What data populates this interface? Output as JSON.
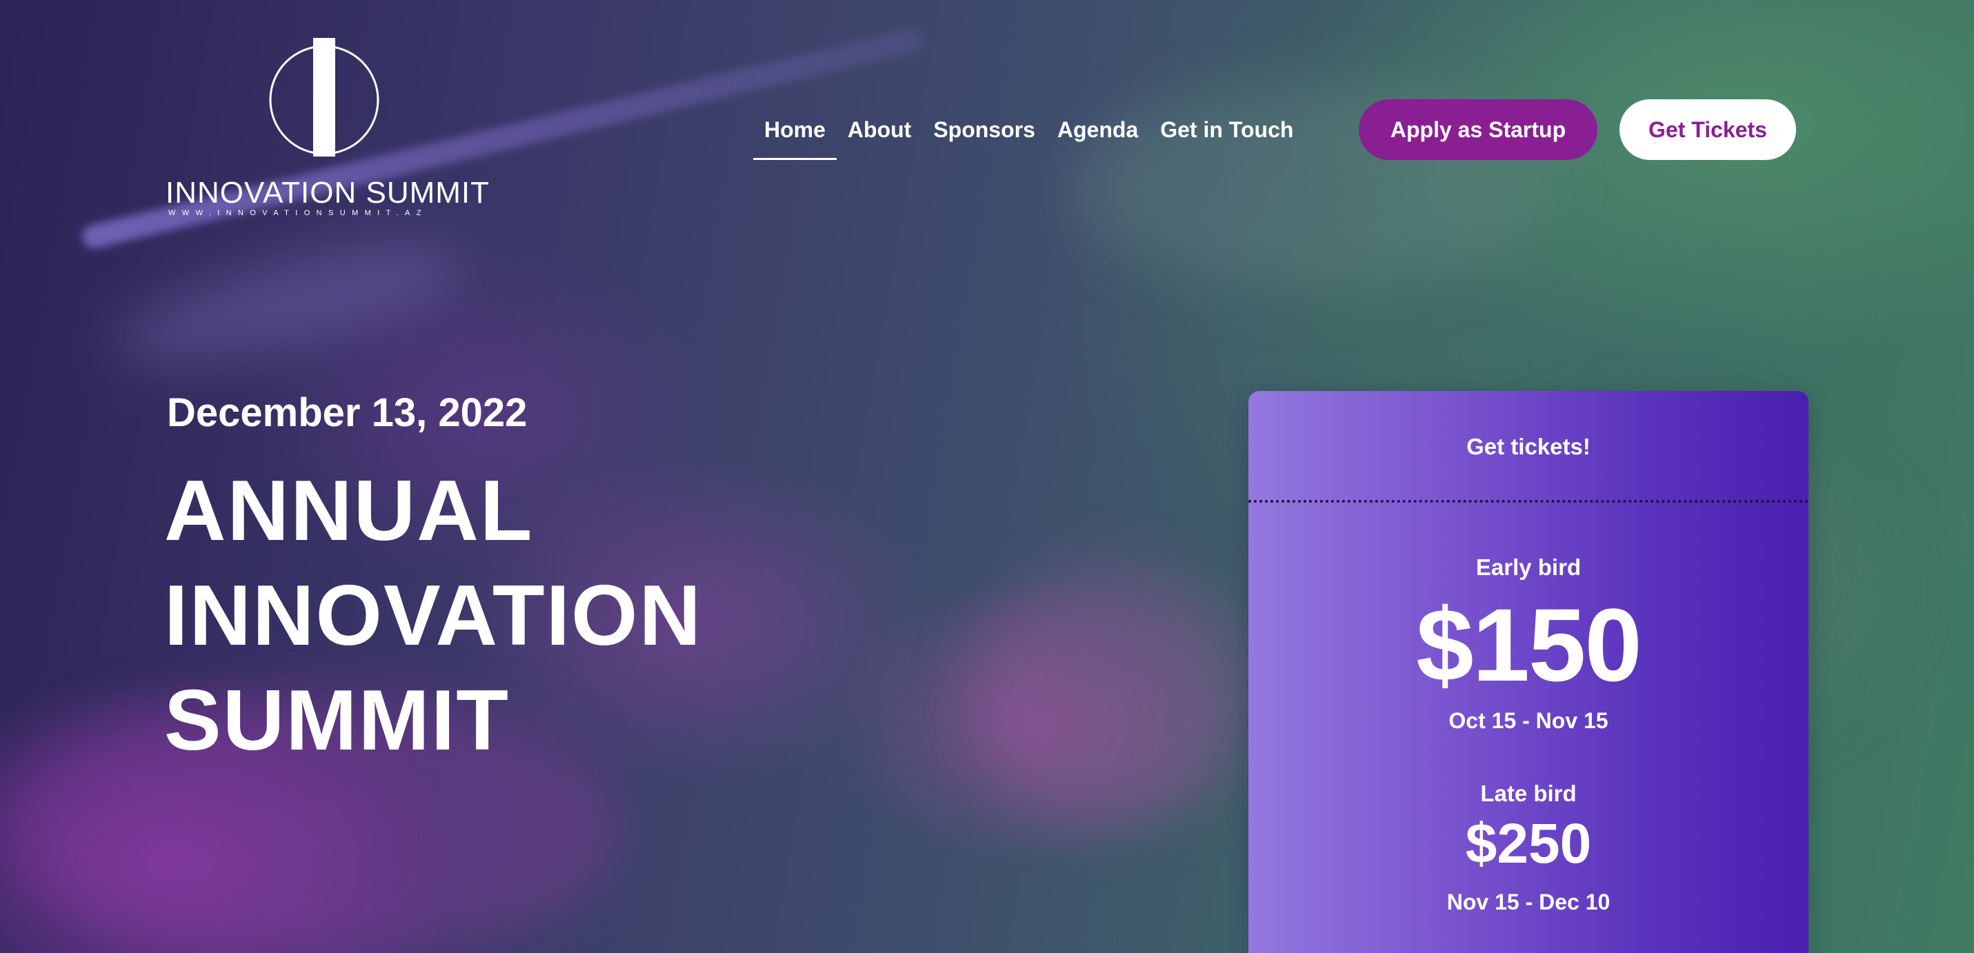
{
  "brand": {
    "name": "INNOVATION SUMMIT",
    "url": "WWW.INNOVATIONSUMMIT.AZ"
  },
  "nav": {
    "items": [
      {
        "label": "Home",
        "active": true
      },
      {
        "label": "About"
      },
      {
        "label": "Sponsors"
      },
      {
        "label": "Agenda"
      },
      {
        "label": "Get in Touch"
      }
    ],
    "apply_label": "Apply as Startup",
    "tickets_label": "Get Tickets"
  },
  "hero": {
    "date": "December 13, 2022",
    "title_lines": [
      "ANNUAL",
      "INNOVATION",
      "SUMMIT"
    ]
  },
  "tickets": {
    "heading": "Get tickets!",
    "tiers": [
      {
        "label": "Early bird",
        "price": "$150",
        "dates": "Oct 15 - Nov 15"
      },
      {
        "label": "Late bird",
        "price": "$250",
        "dates": "Nov 15 - Dec 10"
      }
    ]
  },
  "colors": {
    "accent": "#8a1f94",
    "card_start": "#9378de",
    "card_end": "#4a1fb0"
  }
}
